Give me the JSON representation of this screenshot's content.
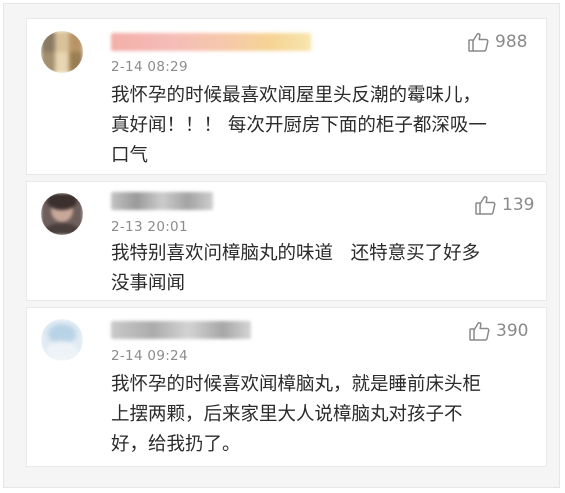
{
  "comments": [
    {
      "time": "2-14 08:29",
      "likes": "988",
      "text": "我怀孕的时候最喜欢闻屋里头反潮的霉味儿，\n真好闻！！！ 每次开厨房下面的柜子都深吸一\n口气"
    },
    {
      "time": "2-13 20:01",
      "likes": "139",
      "text": "我特别喜欢问樟脑丸的味道   还特意买了好多\n没事闻闻"
    },
    {
      "time": "2-14 09:24",
      "likes": "390",
      "text": "我怀孕的时候喜欢闻樟脑丸，就是睡前床头柜\n上摆两颗，后来家里大人说樟脑丸对孩子不\n好，给我扔了。"
    }
  ],
  "icons": {
    "like": "thumbs-up-icon"
  },
  "colors": {
    "background": "#f5f5f5",
    "card": "#ffffff",
    "text": "#2b2b2b",
    "meta": "#8c8c8c"
  }
}
